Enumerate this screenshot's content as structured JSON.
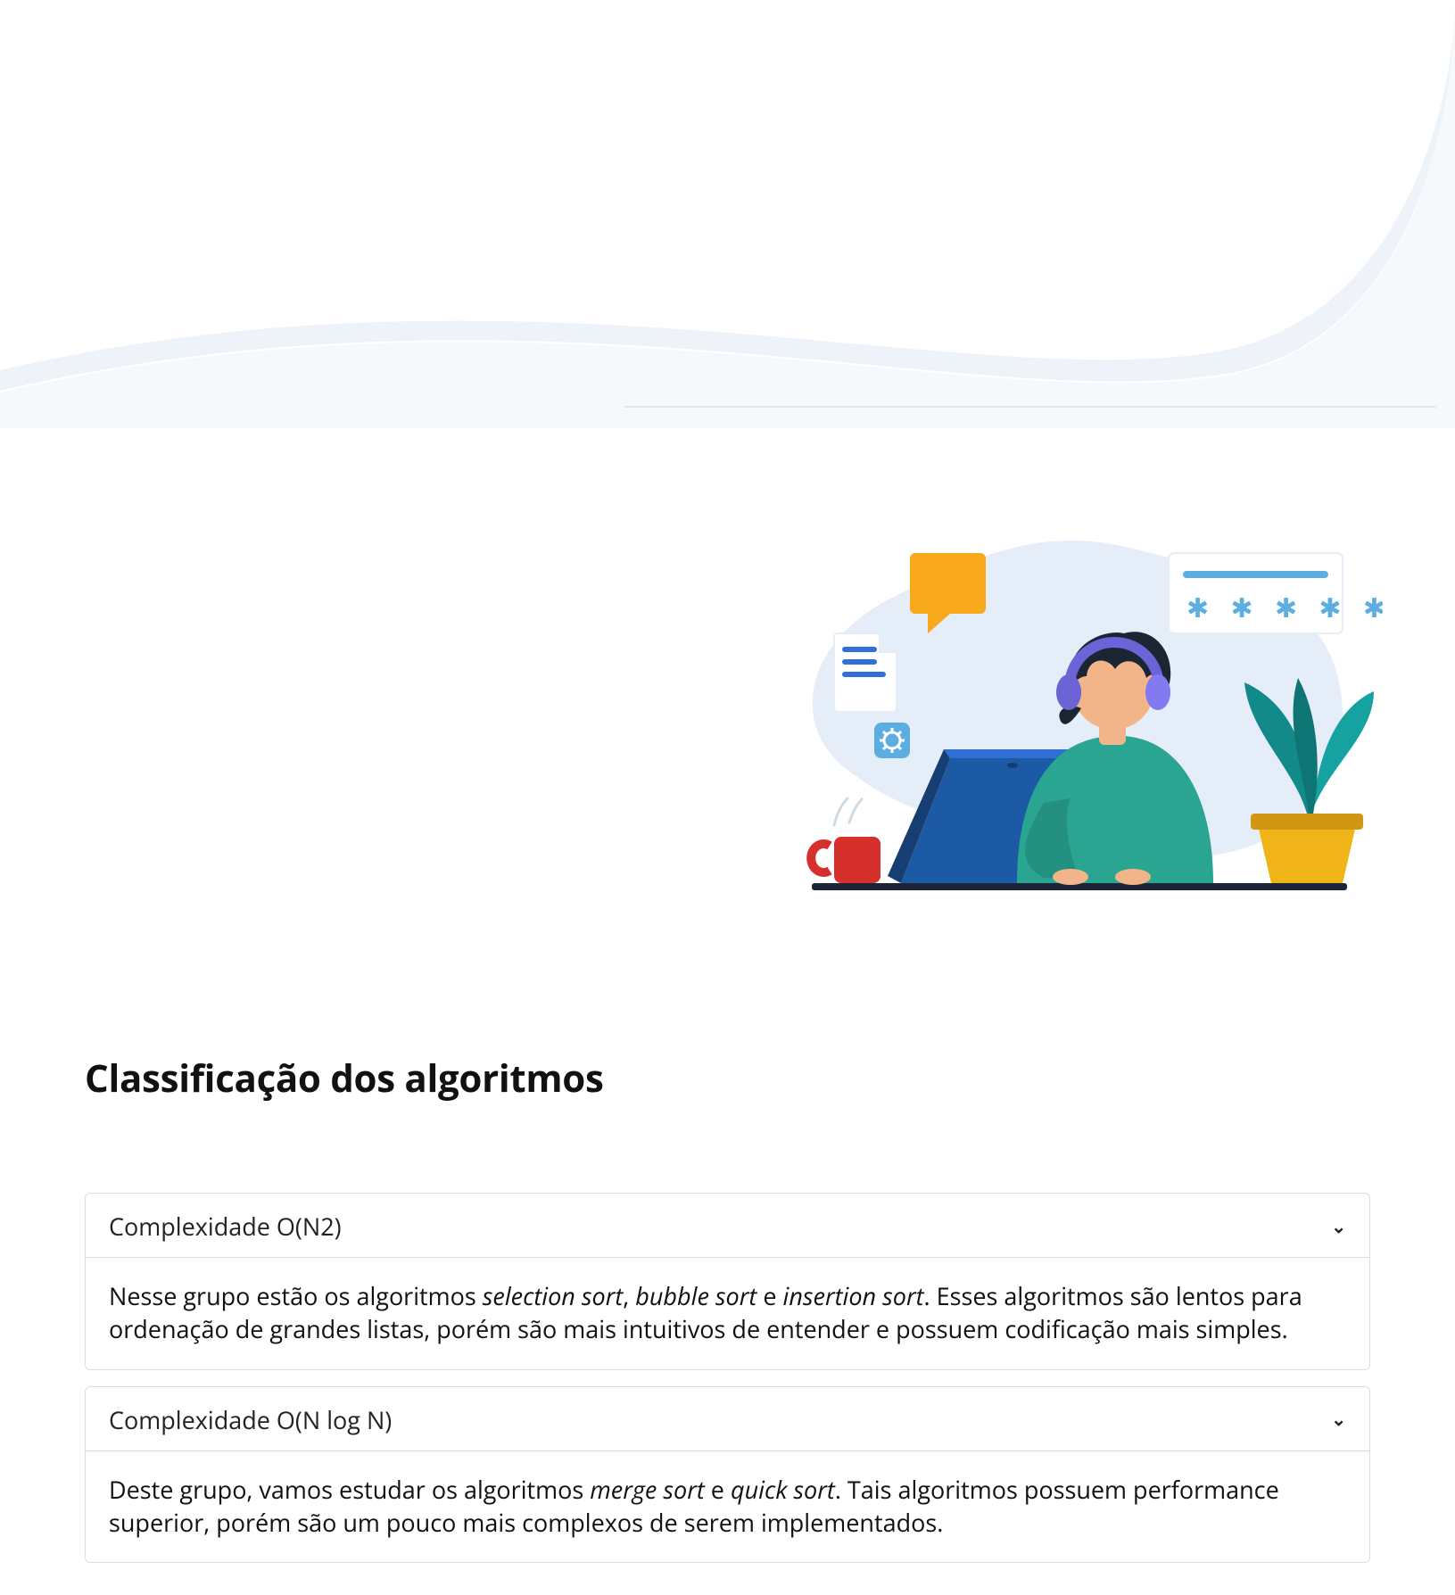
{
  "hero_separator_visible": true,
  "section": {
    "title": "Classificação dos algoritmos"
  },
  "accordions": [
    {
      "title": "Complexidade O(N2)",
      "body_pre": "Nesse grupo estão os algoritmos ",
      "algs": [
        "selection sort",
        "bubble sort",
        "insertion sort"
      ],
      "sep1": ", ",
      "sep2": " e ",
      "body_post": ". Esses algoritmos são lentos para ordenação de grandes listas, porém são mais intuitivos de entender e possuem codificação mais simples."
    },
    {
      "title": "Complexidade O(N log N)",
      "body_pre": "Deste grupo, vamos estudar os algoritmos ",
      "algs": [
        "merge sort",
        "quick sort"
      ],
      "sep1": " e ",
      "body_post": ". Tais algoritmos possuem performance superior, porém são um pouco mais complexos de serem implementados."
    }
  ]
}
